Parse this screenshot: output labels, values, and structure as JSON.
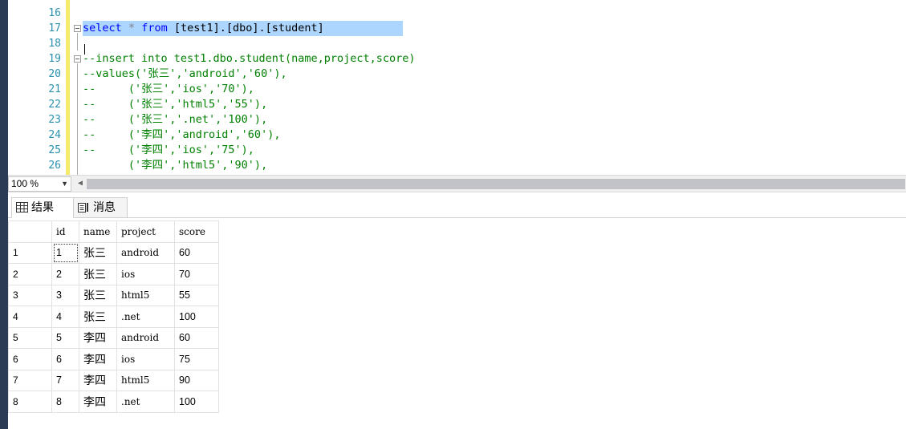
{
  "editor": {
    "lines": [
      {
        "num": "16",
        "text": ""
      },
      {
        "num": "17",
        "parts": [
          {
            "t": "select",
            "c": "kw"
          },
          {
            "t": " ",
            "c": ""
          },
          {
            "t": "*",
            "c": "op"
          },
          {
            "t": " ",
            "c": ""
          },
          {
            "t": "from",
            "c": "kw"
          },
          {
            "t": " [test1].[dbo].[student]",
            "c": ""
          }
        ],
        "selected": true
      },
      {
        "num": "18",
        "text": ""
      },
      {
        "num": "19",
        "comment": "--insert into test1.dbo.student(name,project,score)"
      },
      {
        "num": "20",
        "comment": "--values('张三','android','60'),"
      },
      {
        "num": "21",
        "comment": "--     ('张三','ios','70'),"
      },
      {
        "num": "22",
        "comment": "--     ('张三','html5','55'),"
      },
      {
        "num": "23",
        "comment": "--     ('张三','.net','100'),"
      },
      {
        "num": "24",
        "comment": "--     ('李四','android','60'),"
      },
      {
        "num": "25",
        "comment": "--     ('李四','ios','75'),"
      },
      {
        "num": "26",
        "comment": "       ('李四','html5','90'),"
      }
    ]
  },
  "zoom": {
    "value": "100 %"
  },
  "tabs": [
    {
      "label": "结果",
      "icon": "grid-icon",
      "active": true
    },
    {
      "label": "消息",
      "icon": "messages-icon",
      "active": false
    }
  ],
  "grid": {
    "columns": [
      "id",
      "name",
      "project",
      "score"
    ],
    "rows": [
      {
        "rownum": "1",
        "id": "1",
        "name": "张三",
        "project": "android",
        "score": "60"
      },
      {
        "rownum": "2",
        "id": "2",
        "name": "张三",
        "project": "ios",
        "score": "70"
      },
      {
        "rownum": "3",
        "id": "3",
        "name": "张三",
        "project": "html5",
        "score": "55"
      },
      {
        "rownum": "4",
        "id": "4",
        "name": "张三",
        "project": ".net",
        "score": "100"
      },
      {
        "rownum": "5",
        "id": "5",
        "name": "李四",
        "project": "android",
        "score": "60"
      },
      {
        "rownum": "6",
        "id": "6",
        "name": "李四",
        "project": "ios",
        "score": "75"
      },
      {
        "rownum": "7",
        "id": "7",
        "name": "李四",
        "project": "html5",
        "score": "90"
      },
      {
        "rownum": "8",
        "id": "8",
        "name": "李四",
        "project": ".net",
        "score": "100"
      }
    ]
  },
  "colors": {
    "keyword": "#0000ff",
    "comment": "#008000",
    "line_number": "#2b91af",
    "selection": "#add6ff"
  }
}
